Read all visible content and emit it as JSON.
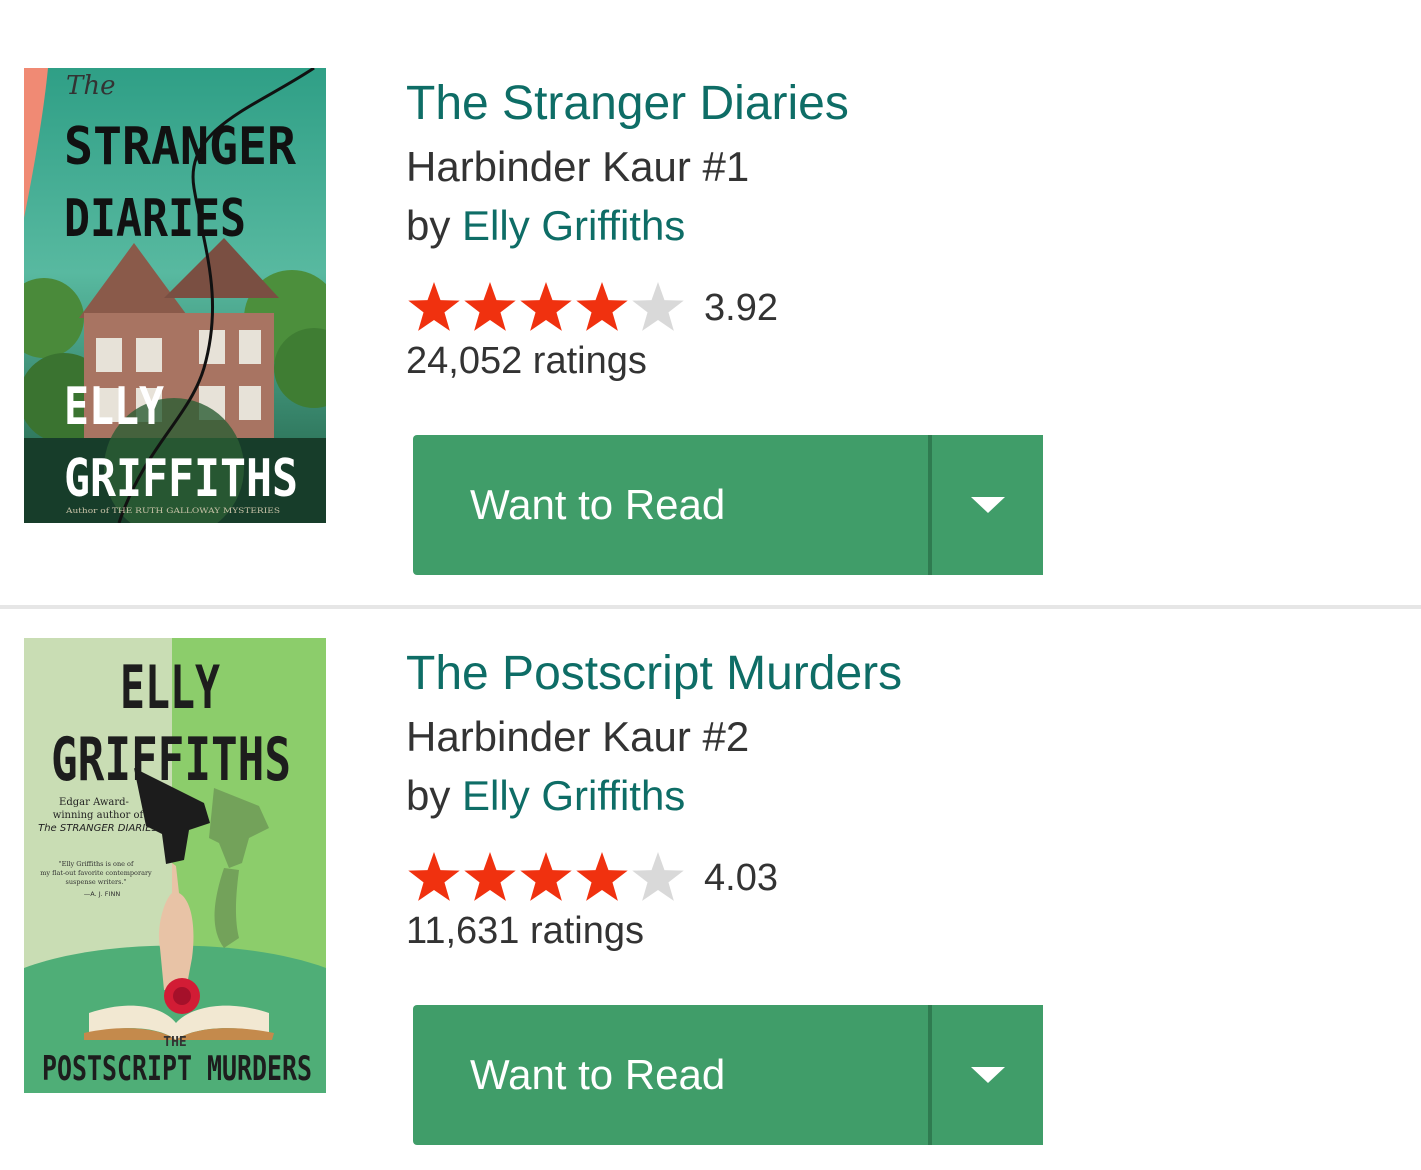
{
  "colors": {
    "link": "#0e6d66",
    "text": "#333333",
    "star_on": "#f0310f",
    "star_off": "#d9d9d9",
    "button": "#409d69",
    "button_separator": "#2f7b50"
  },
  "books": [
    {
      "title": "The Stranger Diaries",
      "series": "Harbinder Kaur #1",
      "by_prefix": "by",
      "author": "Elly Griffiths",
      "rating": "3.92",
      "stars_filled": 4,
      "stars_total": 5,
      "ratings_count": "24,052 ratings",
      "shelf_button": "Want to Read",
      "cover": {
        "lines": [
          "The",
          "STRANGER",
          "DIARIES",
          "ELLY",
          "GRIFFITHS"
        ],
        "footer": "Author of THE RUTH GALLOWAY MYSTERIES"
      }
    },
    {
      "title": "The Postscript Murders",
      "series": "Harbinder Kaur #2",
      "by_prefix": "by",
      "author": "Elly Griffiths",
      "rating": "4.03",
      "stars_filled": 4,
      "stars_total": 5,
      "ratings_count": "11,631 ratings",
      "shelf_button": "Want to Read",
      "cover": {
        "author": [
          "ELLY",
          "GRIFFITHS"
        ],
        "blurb": [
          "Edgar Award-",
          "winning author of",
          "The STRANGER DIARIES"
        ],
        "quote": [
          "\"Elly Griffiths is one of",
          "my flat-out favorite contemporary",
          "suspense writers.\"",
          "—A. J. FINN"
        ],
        "the": "THE",
        "title": "POSTSCRIPT MURDERS"
      }
    }
  ]
}
